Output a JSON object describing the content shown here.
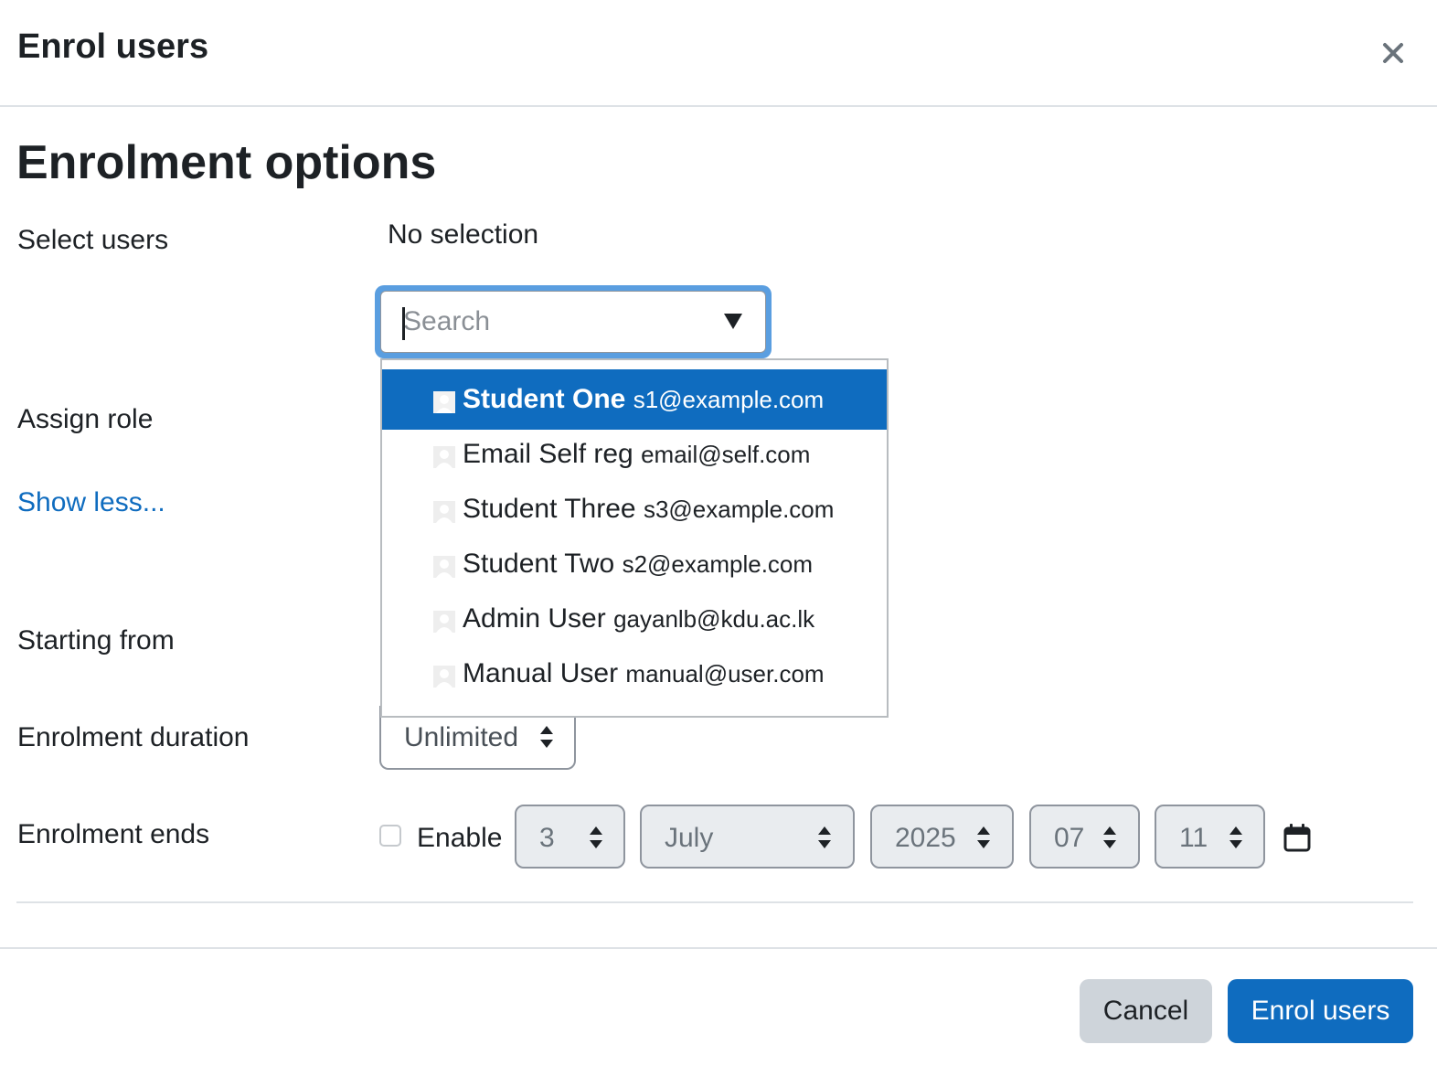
{
  "header": {
    "title": "Enrol users",
    "close_icon": "close-icon"
  },
  "section_title": "Enrolment options",
  "labels": {
    "select_users": "Select users",
    "assign_role": "Assign role",
    "show_less": "Show less...",
    "starting_from": "Starting from",
    "enrolment_duration": "Enrolment duration",
    "enrolment_ends": "Enrolment ends"
  },
  "user_selector": {
    "selection_status": "No selection",
    "search_placeholder": "Search",
    "search_value": "",
    "options": [
      {
        "name": "Student One",
        "email": "s1@example.com",
        "highlighted": true
      },
      {
        "name": "Email Self reg",
        "email": "email@self.com",
        "highlighted": false
      },
      {
        "name": "Student Three",
        "email": "s3@example.com",
        "highlighted": false
      },
      {
        "name": "Student Two",
        "email": "s2@example.com",
        "highlighted": false
      },
      {
        "name": "Admin User",
        "email": "gayanlb@kdu.ac.lk",
        "highlighted": false
      },
      {
        "name": "Manual User",
        "email": "manual@user.com",
        "highlighted": false
      }
    ]
  },
  "duration": {
    "value": "Unlimited"
  },
  "enrolment_ends": {
    "enable_label": "Enable",
    "enabled": false,
    "day": "3",
    "month": "July",
    "year": "2025",
    "hour": "07",
    "minute": "11"
  },
  "footer": {
    "cancel_label": "Cancel",
    "submit_label": "Enrol users"
  },
  "colors": {
    "primary": "#0f6cbf",
    "link": "#0f6cbf",
    "cancel_bg": "#ced4da",
    "disabled_bg": "#e9ecef"
  }
}
